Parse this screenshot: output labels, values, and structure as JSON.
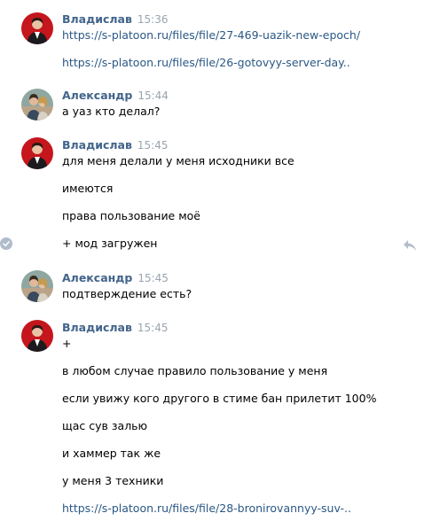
{
  "messages": [
    {
      "author": "Владислав",
      "time": "15:36",
      "avatar": "vladislav-avatar",
      "lines": [
        {
          "text": "https://s-platoon.ru/files/file/27-469-uazik-new-epoch/",
          "link": true
        },
        {
          "text": "https://s-platoon.ru/files/file/26-gotovyy-server-day..",
          "link": true
        }
      ]
    },
    {
      "author": "Александр",
      "time": "15:44",
      "avatar": "alexandr-avatar",
      "lines": [
        {
          "text": "а уаз кто делал?",
          "link": false
        }
      ]
    },
    {
      "author": "Владислав",
      "time": "15:45",
      "avatar": "vladislav-avatar",
      "lines": [
        {
          "text": "для меня делали у меня исходники все",
          "link": false
        },
        {
          "text": "имеются",
          "link": false
        },
        {
          "text": "права пользование моё",
          "link": false
        },
        {
          "text": "+ мод загружен",
          "link": false
        }
      ]
    },
    {
      "author": "Александр",
      "time": "15:45",
      "avatar": "alexandr-avatar",
      "lines": [
        {
          "text": "подтверждение есть?",
          "link": false
        }
      ]
    },
    {
      "author": "Владислав",
      "time": "15:45",
      "avatar": "vladislav-avatar",
      "lines": [
        {
          "text": "+",
          "link": false
        },
        {
          "text": "в любом случае правило пользование у меня",
          "link": false
        },
        {
          "text": "если увижу кого другого в стиме бан прилетит 100%",
          "link": false
        },
        {
          "text": "щас сув залью",
          "link": false
        },
        {
          "text": "и хаммер так же",
          "link": false
        },
        {
          "text": "у меня 3 техники",
          "link": false
        },
        {
          "text": "https://s-platoon.ru/files/file/28-bronirovannyy-suv-..",
          "link": true
        }
      ]
    }
  ],
  "icons": {
    "selected": "check-icon",
    "reply": "reply-icon"
  },
  "colors": {
    "author": "#42648b",
    "time": "#9aa4b0",
    "link": "#2a5885",
    "text": "#000000"
  }
}
